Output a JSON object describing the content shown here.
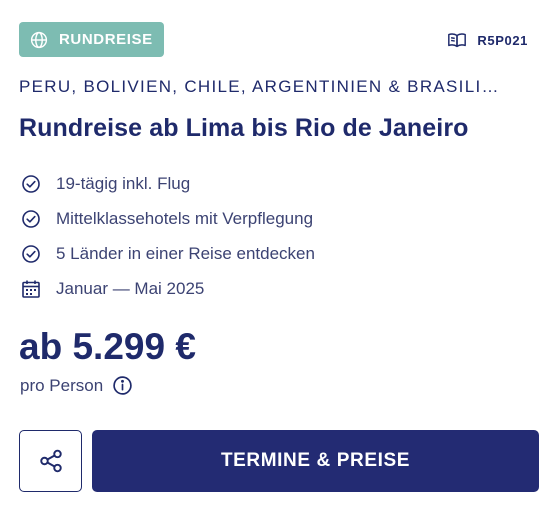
{
  "badge": {
    "label": "RUNDREISE",
    "icon": "globe-icon"
  },
  "trip_code": {
    "label": "R5P021",
    "icon": "book-icon"
  },
  "countries": "PERU, BOLIVIEN, CHILE, ARGENTINIEN & BRASILI…",
  "title": "Rundreise ab Lima bis Rio de Janeiro",
  "features": [
    {
      "icon": "check-circle-icon",
      "text": "19-tägig inkl. Flug"
    },
    {
      "icon": "check-circle-icon",
      "text": "Mittelklassehotels mit Verpflegung"
    },
    {
      "icon": "check-circle-icon",
      "text": "5 Länder in einer Reise entdecken"
    },
    {
      "icon": "calendar-icon",
      "text": "Januar — Mai 2025"
    }
  ],
  "price": "ab 5.299 €",
  "price_note": "pro Person",
  "buttons": {
    "share_icon": "share-icon",
    "cta_label": "TERMINE & PREISE"
  },
  "colors": {
    "badge_bg": "#7dbcb2",
    "primary": "#232b73",
    "text": "#1f2a6b"
  }
}
